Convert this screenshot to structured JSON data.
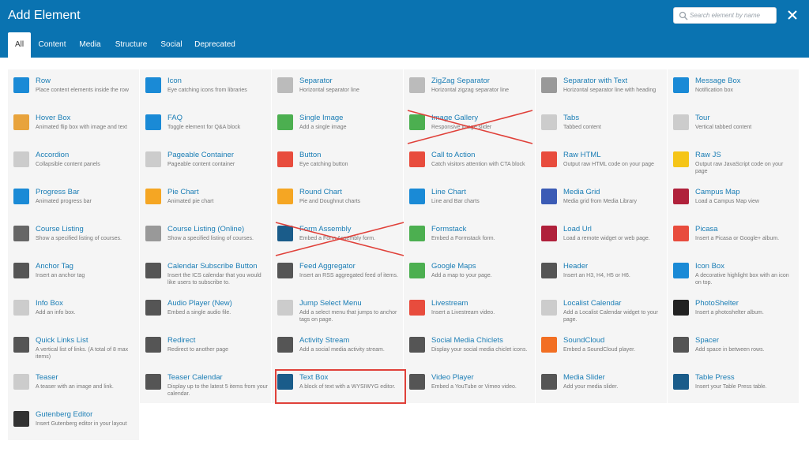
{
  "window": {
    "title": "Add Element",
    "close_icon": "close-icon"
  },
  "search": {
    "placeholder": "Search element by name",
    "value": "",
    "icon": "search-icon"
  },
  "tabs": [
    "All",
    "Content",
    "Media",
    "Structure",
    "Social",
    "Deprecated"
  ],
  "active_tab": "All",
  "colors": {
    "header": "#0a73b1",
    "accent_blue": "#1a7db5",
    "cell_background": "#f5f5f5",
    "annotation_red": "#e0413a"
  },
  "annotations": {
    "crossed_out": [
      "Image Gallery",
      "Form Assembly"
    ],
    "highlighted": "Text Box"
  },
  "elements": [
    {
      "name": "Row",
      "desc": "Place content elements inside the row",
      "icon": "plus-icon",
      "color": "#1a8ad6"
    },
    {
      "name": "Icon",
      "desc": "Eye catching icons from libraries",
      "icon": "gear-icon",
      "color": "#1a8ad6"
    },
    {
      "name": "Separator",
      "desc": "Horizontal separator line",
      "icon": "separator-icon",
      "color": "#bbbbbb"
    },
    {
      "name": "ZigZag Separator",
      "desc": "Horizontal zigzag separator line",
      "icon": "zigzag-icon",
      "color": "#bbbbbb"
    },
    {
      "name": "Separator with Text",
      "desc": "Horizontal separator line with heading",
      "icon": "text-separator-icon",
      "color": "#999999"
    },
    {
      "name": "Message Box",
      "desc": "Notification box",
      "icon": "info-icon",
      "color": "#1a8ad6"
    },
    {
      "name": "Hover Box",
      "desc": "Animated flip box with image and text",
      "icon": "hover-box-icon",
      "color": "#e8a33c"
    },
    {
      "name": "FAQ",
      "desc": "Toggle element for Q&A block",
      "icon": "faq-icon",
      "color": "#1a8ad6"
    },
    {
      "name": "Single Image",
      "desc": "Add a single image",
      "icon": "image-icon",
      "color": "#4caf50"
    },
    {
      "name": "Image Gallery",
      "desc": "Responsive image slider",
      "icon": "gallery-icon",
      "color": "#4caf50"
    },
    {
      "name": "Tabs",
      "desc": "Tabbed content",
      "icon": "tabs-icon",
      "color": "#cccccc"
    },
    {
      "name": "Tour",
      "desc": "Vertical tabbed content",
      "icon": "tour-icon",
      "color": "#cccccc"
    },
    {
      "name": "Accordion",
      "desc": "Collapsible content panels",
      "icon": "accordion-icon",
      "color": "#cccccc"
    },
    {
      "name": "Pageable Container",
      "desc": "Pageable content container",
      "icon": "pageable-icon",
      "color": "#cccccc"
    },
    {
      "name": "Button",
      "desc": "Eye catching button",
      "icon": "go-button-icon",
      "color": "#e84c3d"
    },
    {
      "name": "Call to Action",
      "desc": "Catch visitors attention with CTA block",
      "icon": "cta-icon",
      "color": "#e84c3d"
    },
    {
      "name": "Raw HTML",
      "desc": "Output raw HTML code on your page",
      "icon": "html-icon",
      "color": "#e84c3d"
    },
    {
      "name": "Raw JS",
      "desc": "Output raw JavaScript code on your page",
      "icon": "js-icon",
      "color": "#f5c518"
    },
    {
      "name": "Progress Bar",
      "desc": "Animated progress bar",
      "icon": "progress-bar-icon",
      "color": "#1a8ad6"
    },
    {
      "name": "Pie Chart",
      "desc": "Animated pie chart",
      "icon": "pie-chart-icon",
      "color": "#f5a623"
    },
    {
      "name": "Round Chart",
      "desc": "Pie and Doughnut charts",
      "icon": "round-chart-icon",
      "color": "#f5a623"
    },
    {
      "name": "Line Chart",
      "desc": "Line and Bar charts",
      "icon": "line-chart-icon",
      "color": "#1a8ad6"
    },
    {
      "name": "Media Grid",
      "desc": "Media grid from Media Library",
      "icon": "media-grid-icon",
      "color": "#3b5bb5"
    },
    {
      "name": "Campus Map",
      "desc": "Load a Campus Map view",
      "icon": "campus-map-icon",
      "color": "#b0213b"
    },
    {
      "name": "Course Listing",
      "desc": "Show a specified listing of courses.",
      "icon": "course-listing-icon",
      "color": "#666666"
    },
    {
      "name": "Course Listing (Online)",
      "desc": "Show a specified listing of courses.",
      "icon": "course-online-icon",
      "color": "#999999"
    },
    {
      "name": "Form Assembly",
      "desc": "Embed a Form Assembly form.",
      "icon": "form-assembly-icon",
      "color": "#1a5c8a"
    },
    {
      "name": "Formstack",
      "desc": "Embed a Formstack form.",
      "icon": "formstack-icon",
      "color": "#4caf50"
    },
    {
      "name": "Load Url",
      "desc": "Load a remote widget or web page.",
      "icon": "load-url-icon",
      "color": "#b0213b"
    },
    {
      "name": "Picasa",
      "desc": "Insert a Picasa or Google+ album.",
      "icon": "picasa-icon",
      "color": "#e84c3d"
    },
    {
      "name": "Anchor Tag",
      "desc": "Insert an anchor tag",
      "icon": "anchor-icon",
      "color": "#555555"
    },
    {
      "name": "Calendar Subscribe Button",
      "desc": "Insert the ICS calendar that you would like users to subscribe to.",
      "icon": "calendar-icon",
      "color": "#555555"
    },
    {
      "name": "Feed Aggregator",
      "desc": "Insert an RSS aggregated feed of items.",
      "icon": "feed-icon",
      "color": "#555555"
    },
    {
      "name": "Google Maps",
      "desc": "Add a map to your page.",
      "icon": "map-icon",
      "color": "#4caf50"
    },
    {
      "name": "Header",
      "desc": "Insert an H3, H4, H5 or H6.",
      "icon": "header-icon",
      "color": "#555555"
    },
    {
      "name": "Icon Box",
      "desc": "A decorative highlight box with an icon on top.",
      "icon": "icon-box-icon",
      "color": "#1a8ad6"
    },
    {
      "name": "Info Box",
      "desc": "Add an info box.",
      "icon": "cloud-icon",
      "color": "#cccccc"
    },
    {
      "name": "Audio Player (New)",
      "desc": "Embed a single audio file.",
      "icon": "music-icon",
      "color": "#555555"
    },
    {
      "name": "Jump Select Menu",
      "desc": "Add a select menu that jumps to anchor tags on page.",
      "icon": "cloud-icon",
      "color": "#cccccc"
    },
    {
      "name": "Livestream",
      "desc": "Insert a Livestream video.",
      "icon": "livestream-icon",
      "color": "#e84c3d"
    },
    {
      "name": "Localist Calendar",
      "desc": "Add a Localist Calendar widget to your page.",
      "icon": "cloud-icon",
      "color": "#cccccc"
    },
    {
      "name": "PhotoShelter",
      "desc": "Insert a photoshelter album.",
      "icon": "photoshelter-icon",
      "color": "#222222"
    },
    {
      "name": "Quick Links List",
      "desc": "A vertical list of links. (A total of 8 max items)",
      "icon": "list-icon",
      "color": "#555555"
    },
    {
      "name": "Redirect",
      "desc": "Redirect to another page",
      "icon": "redirect-icon",
      "color": "#555555"
    },
    {
      "name": "Activity Stream",
      "desc": "Add a social media activity stream.",
      "icon": "share-icon",
      "color": "#555555"
    },
    {
      "name": "Social Media Chiclets",
      "desc": "Display your social media chiclet icons.",
      "icon": "chiclets-icon",
      "color": "#555555"
    },
    {
      "name": "SoundCloud",
      "desc": "Embed a SoundCloud player.",
      "icon": "soundcloud-icon",
      "color": "#f26f23"
    },
    {
      "name": "Spacer",
      "desc": "Add space in between rows.",
      "icon": "spacer-icon",
      "color": "#555555"
    },
    {
      "name": "Teaser",
      "desc": "A teaser with an image and link.",
      "icon": "teaser-icon",
      "color": "#cccccc"
    },
    {
      "name": "Teaser Calendar",
      "desc": "Display up to the latest 5 items from your calendar.",
      "icon": "calendar-icon",
      "color": "#555555"
    },
    {
      "name": "Text Box",
      "desc": "A block of text with a WYSIWYG editor.",
      "icon": "text-box-icon",
      "color": "#1a5c8a"
    },
    {
      "name": "Video Player",
      "desc": "Embed a YouTube or Vimeo video.",
      "icon": "video-icon",
      "color": "#555555"
    },
    {
      "name": "Media Slider",
      "desc": "Add your media slider.",
      "icon": "slider-icon",
      "color": "#555555"
    },
    {
      "name": "Table Press",
      "desc": "Insert your Table Press table.",
      "icon": "table-icon",
      "color": "#1a5c8a"
    },
    {
      "name": "Gutenberg Editor",
      "desc": "Insert Gutenberg editor in your layout",
      "icon": "gutenberg-icon",
      "color": "#333333"
    }
  ]
}
